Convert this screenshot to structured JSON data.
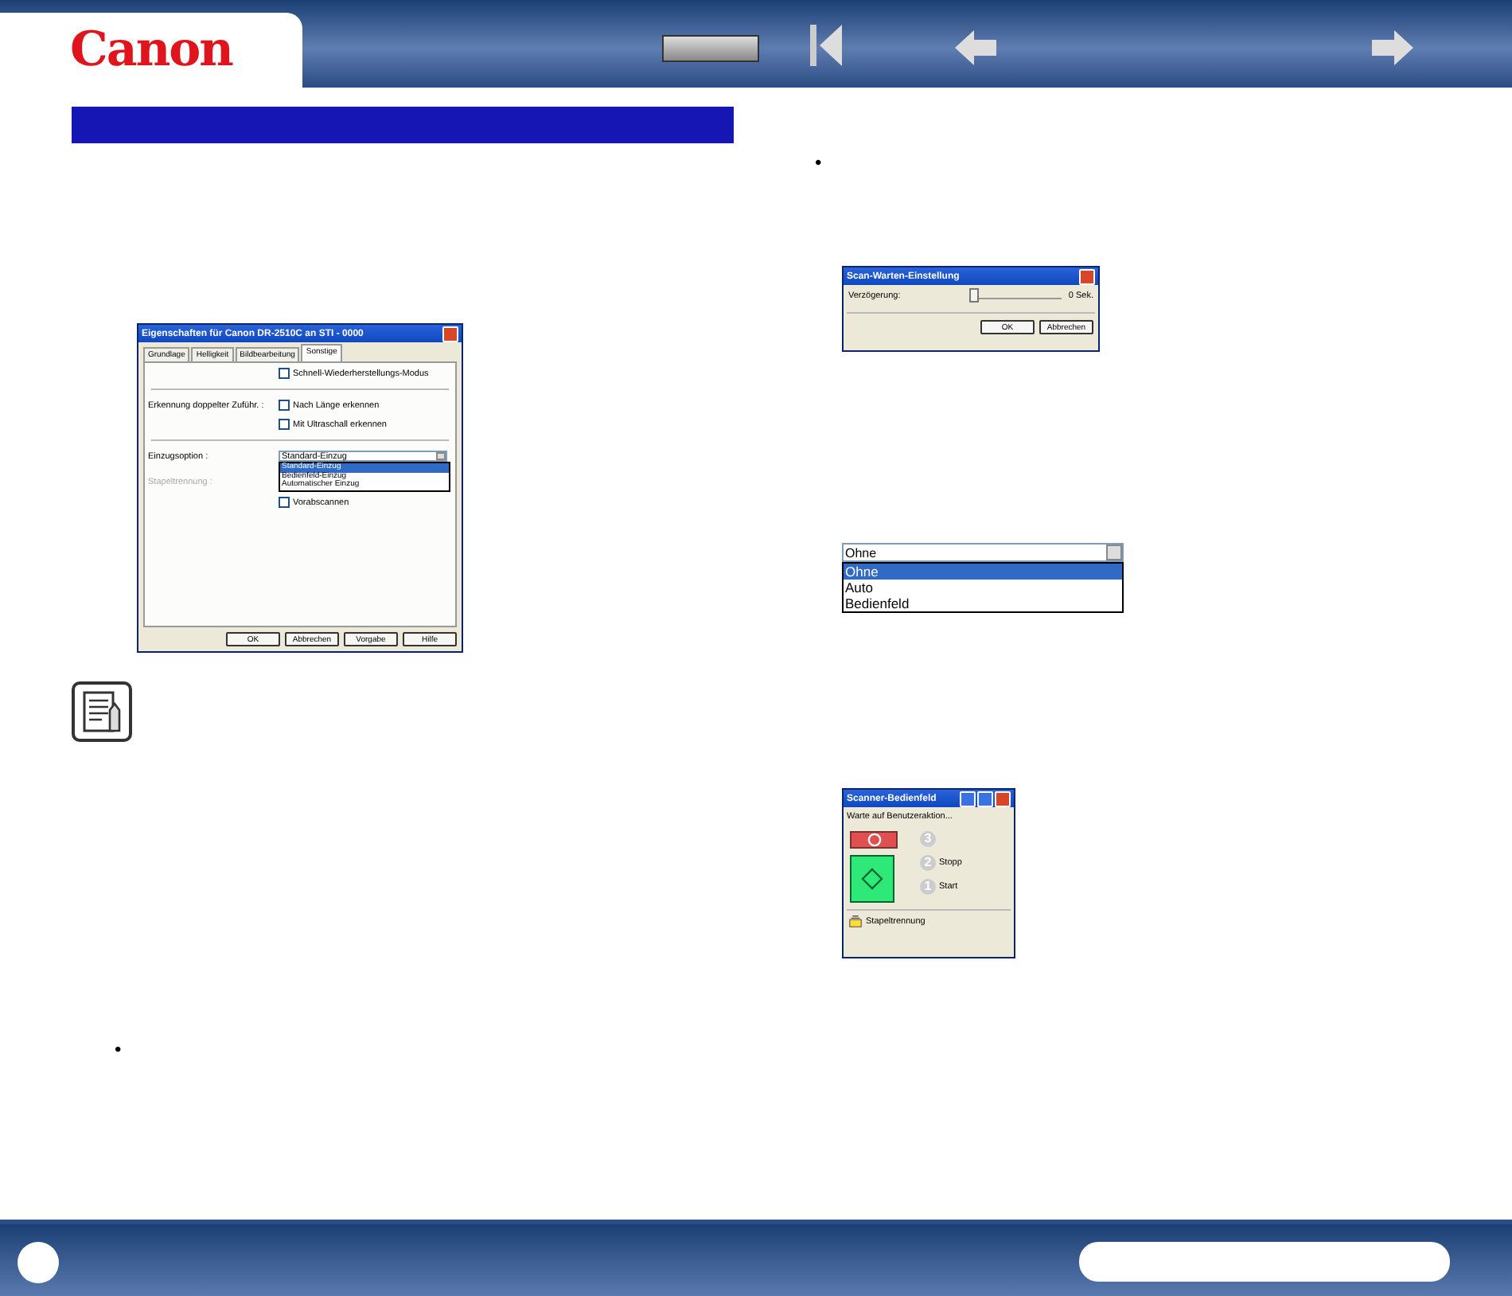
{
  "header": {
    "logo": "Canon"
  },
  "bullets": [
    "•",
    "•"
  ],
  "props_dialog": {
    "title": "Eigenschaften für Canon DR-2510C an STI - 0000",
    "tabs": [
      {
        "label": "Grundlage",
        "selected": false
      },
      {
        "label": "Helligkeit",
        "selected": false
      },
      {
        "label": "Bildbearbeitung",
        "selected": false
      },
      {
        "label": "Sonstige",
        "selected": true
      }
    ],
    "quick_mode": {
      "label": "Schnell-Wiederherstellungs-Modus",
      "checked": false
    },
    "double_feed_label": "Erkennung doppelter Zuführ. :",
    "double_feed": [
      {
        "label": "Nach Länge erkennen",
        "checked": false
      },
      {
        "label": "Mit Ultraschall erkennen",
        "checked": false
      }
    ],
    "feed_label": "Einzugsoption :",
    "feed_value": "Standard-Einzug",
    "feed_options": [
      {
        "label": "Standard-Einzug",
        "selected": true
      },
      {
        "label": "Bedienfeld-Einzug",
        "selected": false
      },
      {
        "label": "Automatischer Einzug",
        "selected": false
      }
    ],
    "separation_label": "Stapeltrennung :",
    "prescan": {
      "label": "Vorabscannen",
      "checked": false
    },
    "buttons": [
      "OK",
      "Abbrechen",
      "Vorgabe",
      "Hilfe"
    ]
  },
  "wait_dialog": {
    "title": "Scan-Warten-Einstellung",
    "label": "Verzögerung:",
    "level": 0,
    "reading": "0 Sek.",
    "buttons": [
      "OK",
      "Abbrechen"
    ]
  },
  "dropdown": {
    "value": "Ohne",
    "options": [
      {
        "label": "Ohne",
        "selected": true
      },
      {
        "label": "Auto",
        "selected": false
      },
      {
        "label": "Bedienfeld",
        "selected": false
      }
    ]
  },
  "panel": {
    "title": "Scanner-Bedienfeld",
    "status": "Warte auf Benutzeraktion...",
    "steps": [
      {
        "number": "3"
      },
      {
        "number": "2",
        "label": "Stopp"
      },
      {
        "number": "1",
        "label": "Start"
      }
    ],
    "separation": "Stapeltrennung"
  }
}
